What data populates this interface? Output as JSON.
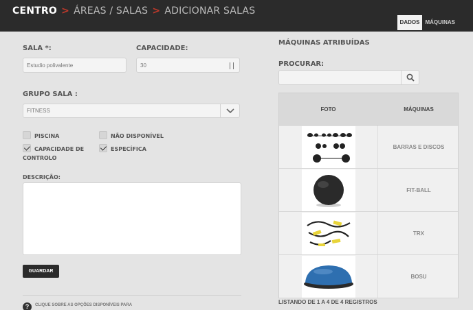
{
  "breadcrumb": {
    "root": "CENTRO",
    "separator": ">",
    "level1": "ÁREAS / SALAS",
    "level2": "ADICIONAR SALAS"
  },
  "tabs": [
    {
      "label": "DADOS",
      "active": true
    },
    {
      "label": "MÁQUINAS",
      "active": false
    }
  ],
  "form": {
    "sala_label": "SALA *:",
    "sala_value": "Estudio polivalente",
    "capacidade_label": "CAPACIDADE:",
    "capacidade_value": "30",
    "grupo_label": "GRUPO SALA :",
    "grupo_value": "FITNESS",
    "checkboxes": [
      {
        "label": "PISCINA",
        "checked": false
      },
      {
        "label": "NÃO DISPONÍVEL",
        "checked": false
      },
      {
        "label": "CAPACIDADE DE CONTROLO",
        "checked": true
      },
      {
        "label": "ESPECÍFICA",
        "checked": true
      }
    ],
    "descricao_label": "DESCRIÇÃO:",
    "descricao_value": "",
    "save_label": "GUARDAR",
    "help_icon": "?",
    "help_text": "CLIQUE SOBRE AS OPÇÕES DISPONÍVEIS PARA"
  },
  "machines": {
    "title": "MÁQUINAS ATRIBUÍDAS",
    "search_label": "PROCURAR:",
    "search_value": "",
    "columns": [
      "FOTO",
      "MÁQUINAS"
    ],
    "rows": [
      {
        "name": "BARRAS E DISCOS",
        "icon": "barbell-photo"
      },
      {
        "name": "FIT-BALL",
        "icon": "fitball-photo"
      },
      {
        "name": "TRX",
        "icon": "trx-photo"
      },
      {
        "name": "BOSU",
        "icon": "bosu-photo"
      }
    ],
    "count_text": "LISTANDO DE 1 A 4 DE 4 REGISTROS"
  },
  "colors": {
    "topbar": "#2b2b2b",
    "accent_red": "#c0392b",
    "bosu_blue": "#2e6fb0",
    "trx_yellow": "#e8d43a"
  }
}
